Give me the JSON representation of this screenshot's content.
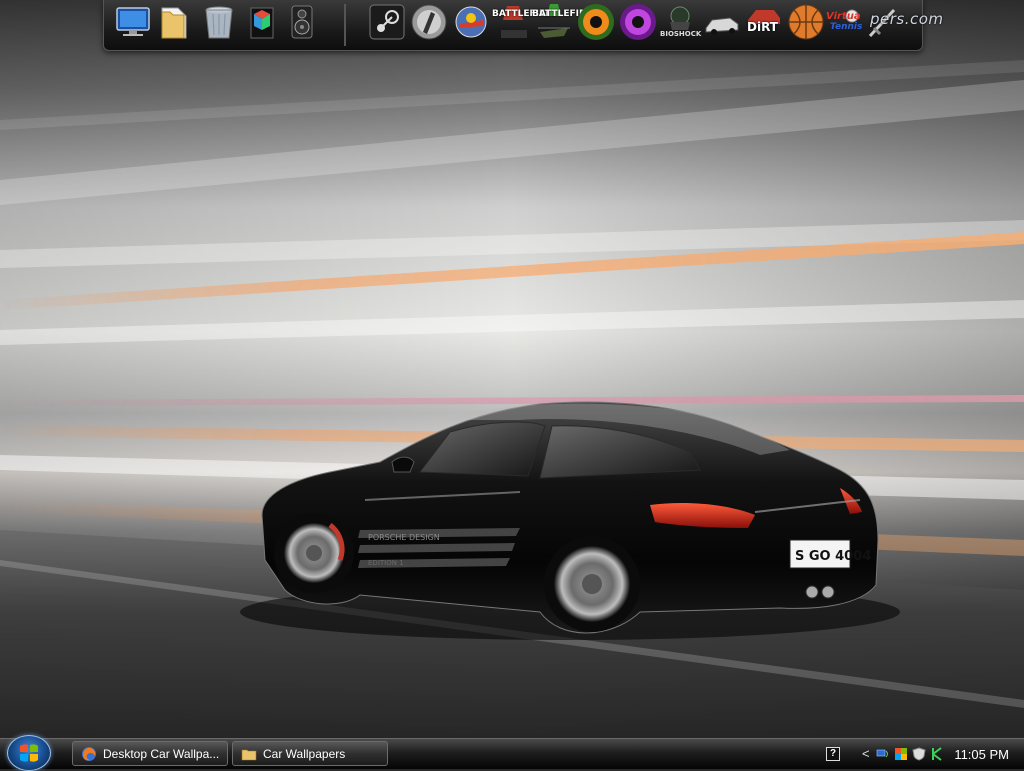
{
  "dock": {
    "icons": [
      {
        "name": "monitor-icon"
      },
      {
        "name": "folder-icon"
      },
      {
        "name": "recycle-bin-icon"
      },
      {
        "name": "cube-app-icon"
      },
      {
        "name": "speaker-icon"
      },
      {
        "name": "steam-icon"
      },
      {
        "name": "counter-strike-icon"
      },
      {
        "name": "game-icon"
      },
      {
        "name": "battlefield-icon"
      },
      {
        "name": "battlefield-helicopter-icon"
      },
      {
        "name": "eye-orange-icon"
      },
      {
        "name": "eye-purple-icon"
      },
      {
        "name": "bioshock-icon"
      },
      {
        "name": "racing-car-icon"
      },
      {
        "name": "dirt-icon"
      },
      {
        "name": "basketball-icon"
      },
      {
        "name": "virtua-tennis-icon"
      },
      {
        "name": "sword-icon"
      }
    ],
    "labels": {
      "battlefield_1": "BATTLEFIELD",
      "battlefield_2": "BATTLEFIELD",
      "bioshock": "BIOSHOCK",
      "dirt": "DiRT",
      "virtua_tennis_1": "Virtua",
      "virtua_tennis_2": "Tennis",
      "brand": "pers.com"
    }
  },
  "wallpaper": {
    "license_plate": "S GO 4004",
    "door_text_1": "PORSCHE DESIGN",
    "door_text_2": "EDITION 1"
  },
  "taskbar": {
    "start_icon": "windows-logo-icon",
    "tasks": [
      {
        "label": "Desktop Car Wallpa...",
        "icon": "firefox-icon"
      },
      {
        "label": "Car Wallpapers",
        "icon": "folder-icon"
      }
    ],
    "tray": {
      "icons": [
        "help-icon",
        "chevron-left-icon",
        "network-icon",
        "color-flag-icon",
        "shield-icon",
        "app-tray-icon"
      ],
      "help_glyph": "?",
      "chevron_glyph": "<",
      "clock": "11:05 PM"
    }
  }
}
